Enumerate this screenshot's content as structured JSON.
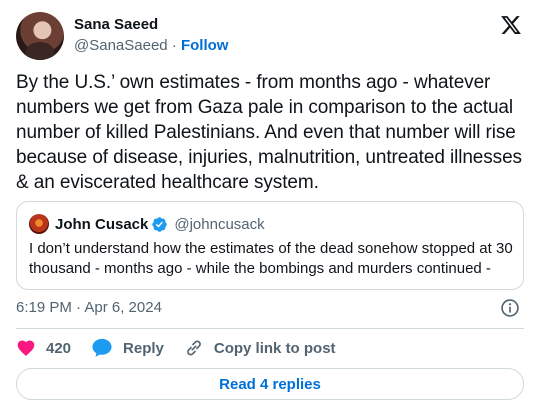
{
  "author": {
    "name": "Sana Saeed",
    "handle": "@SanaSaeed",
    "separator": "·",
    "follow_label": "Follow"
  },
  "tweet_text": "By the U.S.’ own estimates - from months ago - whatever numbers we get from Gaza pale in comparison to the actual number of killed Palestinians. And even that number will rise because of disease, injuries, malnutrition, untreated illnesses & an eviscerated healthcare system.",
  "quote": {
    "name": "John Cusack",
    "handle": "@johncusack",
    "text": "I don’t understand how the estimates of the dead sonehow stopped at 30 thousand - months ago - while the bombings and murders continued -"
  },
  "timestamp": "6:19 PM · Apr 6, 2024",
  "actions": {
    "like_count": "420",
    "reply_label": "Reply",
    "copy_link_label": "Copy link to post"
  },
  "read_replies_label": "Read 4 replies",
  "colors": {
    "like": "#f91880",
    "reply": "#1d9bf0",
    "link": "#006fd6",
    "verified": "#1d9bf0"
  },
  "icons": [
    "x-logo-icon",
    "verified-badge-icon",
    "info-icon",
    "heart-icon",
    "reply-bubble-icon",
    "link-icon"
  ]
}
